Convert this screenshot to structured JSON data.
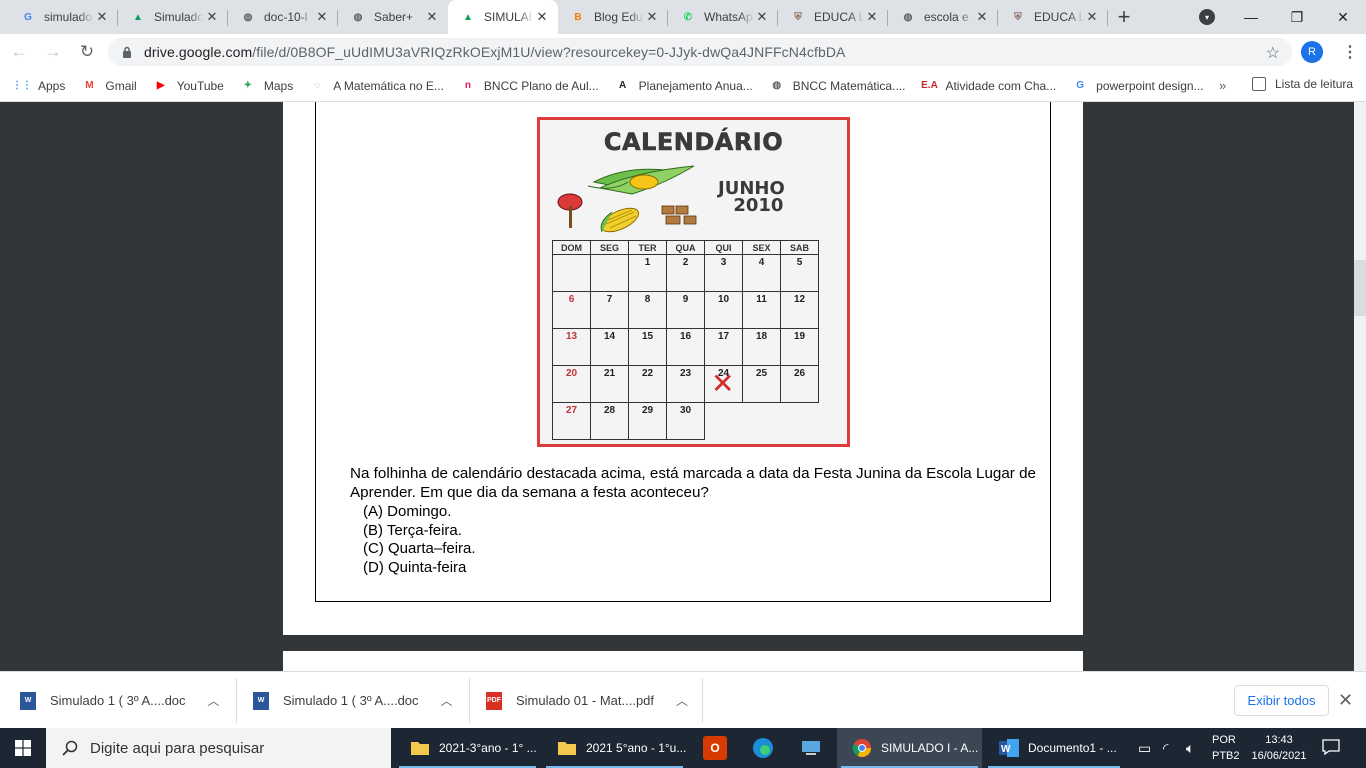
{
  "browser": {
    "tabs": [
      {
        "title": "simulado",
        "icon": "google-icon",
        "color": "#4285f4",
        "glyph": "G"
      },
      {
        "title": "Simulado",
        "icon": "drive-icon",
        "color": "#0f9d58",
        "glyph": "▲"
      },
      {
        "title": "doc-10-l",
        "icon": "globe-icon",
        "color": "#5f6368",
        "glyph": "◍"
      },
      {
        "title": "Saber+",
        "icon": "globe-icon",
        "color": "#5f6368",
        "glyph": "◍"
      },
      {
        "title": "SIMULAI",
        "icon": "drive-icon",
        "color": "#0f9d58",
        "glyph": "▲",
        "active": true
      },
      {
        "title": "Blog Edu",
        "icon": "blogger-icon",
        "color": "#f57d00",
        "glyph": "B"
      },
      {
        "title": "WhatsAp",
        "icon": "whatsapp-icon",
        "color": "#25d366",
        "glyph": "✆"
      },
      {
        "title": "EDUCA L",
        "icon": "crest-icon",
        "color": "#8d6e63",
        "glyph": "⛨"
      },
      {
        "title": "escola e",
        "icon": "globe-icon",
        "color": "#5f6368",
        "glyph": "◍"
      },
      {
        "title": "EDUCA L",
        "icon": "crest-icon",
        "color": "#8d6e63",
        "glyph": "⛨"
      }
    ],
    "url_host": "drive.google.com",
    "url_path": "/file/d/0B8OF_uUdIMU3aVRIQzRkOExjM1U/view?resourcekey=0-JJyk-dwQa4JNFFcN4cfbDA",
    "avatar_letter": "R",
    "bookmarks": [
      {
        "label": "Apps",
        "icon": "apps-grid-icon",
        "color": "#4285f4",
        "glyph": "⋮⋮"
      },
      {
        "label": "Gmail",
        "icon": "gmail-icon",
        "color": "#ea4335",
        "glyph": "M"
      },
      {
        "label": "YouTube",
        "icon": "youtube-icon",
        "color": "#ff0000",
        "glyph": "▶"
      },
      {
        "label": "Maps",
        "icon": "maps-icon",
        "color": "#34a853",
        "glyph": "✦"
      },
      {
        "label": "A Matemática no E...",
        "icon": "site-icon",
        "color": "#9e9e9e",
        "glyph": "◌"
      },
      {
        "label": "BNCC Plano de Aul...",
        "icon": "n-icon",
        "color": "#e91e63",
        "glyph": "n"
      },
      {
        "label": "Planejamento Anua...",
        "icon": "a-icon",
        "color": "#212121",
        "glyph": "A"
      },
      {
        "label": "BNCC Matemática....",
        "icon": "globe-icon",
        "color": "#5f6368",
        "glyph": "◍"
      },
      {
        "label": "Atividade com Cha...",
        "icon": "ea-icon",
        "color": "#c62828",
        "glyph": "E.A"
      },
      {
        "label": "powerpoint design...",
        "icon": "google-icon",
        "color": "#4285f4",
        "glyph": "G"
      }
    ],
    "reading_list": "Lista de leitura"
  },
  "document": {
    "calendar": {
      "title": "CALENDÁRIO",
      "month": "JUNHO",
      "year": "2010",
      "weekdays": [
        "DOM",
        "SEG",
        "TER",
        "QUA",
        "QUI",
        "SEX",
        "SAB"
      ],
      "weeks": [
        [
          "",
          "",
          "1",
          "2",
          "3",
          "4",
          "5"
        ],
        [
          "6",
          "7",
          "8",
          "9",
          "10",
          "11",
          "12"
        ],
        [
          "13",
          "14",
          "15",
          "16",
          "17",
          "18",
          "19"
        ],
        [
          "20",
          "21",
          "22",
          "23",
          "24",
          "25",
          "26"
        ],
        [
          "27",
          "28",
          "29",
          "30",
          "",
          "",
          ""
        ]
      ],
      "marked_day": "24",
      "mark_glyph": "✕"
    },
    "question": "Na folhinha de calendário destacada acima, está marcada a data da Festa Junina da Escola Lugar de Aprender. Em que dia da semana a festa aconteceu?",
    "options": [
      "(A) Domingo.",
      "(B) Terça-feira.",
      "(C) Quarta–feira.",
      "(D) Quinta-feira"
    ]
  },
  "downloads": {
    "items": [
      {
        "name": "Simulado 1 ( 3º A....doc",
        "icon": "word-doc-icon",
        "color": "#2b579a",
        "glyph": "W"
      },
      {
        "name": "Simulado 1 ( 3º A....doc",
        "icon": "word-doc-icon",
        "color": "#2b579a",
        "glyph": "W"
      },
      {
        "name": "Simulado 01 - Mat....pdf",
        "icon": "pdf-icon",
        "color": "#d93025",
        "glyph": "PDF"
      }
    ],
    "show_all": "Exibir todos"
  },
  "taskbar": {
    "search_placeholder": "Digite aqui para pesquisar",
    "items": [
      {
        "label": "2021-3°ano - 1° ...",
        "icon": "folder-icon"
      },
      {
        "label": "2021 5°ano - 1°u...",
        "icon": "folder-icon"
      },
      {
        "label": "SIMULADO I - A...",
        "icon": "chrome-icon"
      },
      {
        "label": "Documento1 - ...",
        "icon": "word-icon"
      }
    ],
    "lang_top": "POR",
    "lang_bottom": "PTB2",
    "time": "13:43",
    "date": "16/06/2021"
  }
}
